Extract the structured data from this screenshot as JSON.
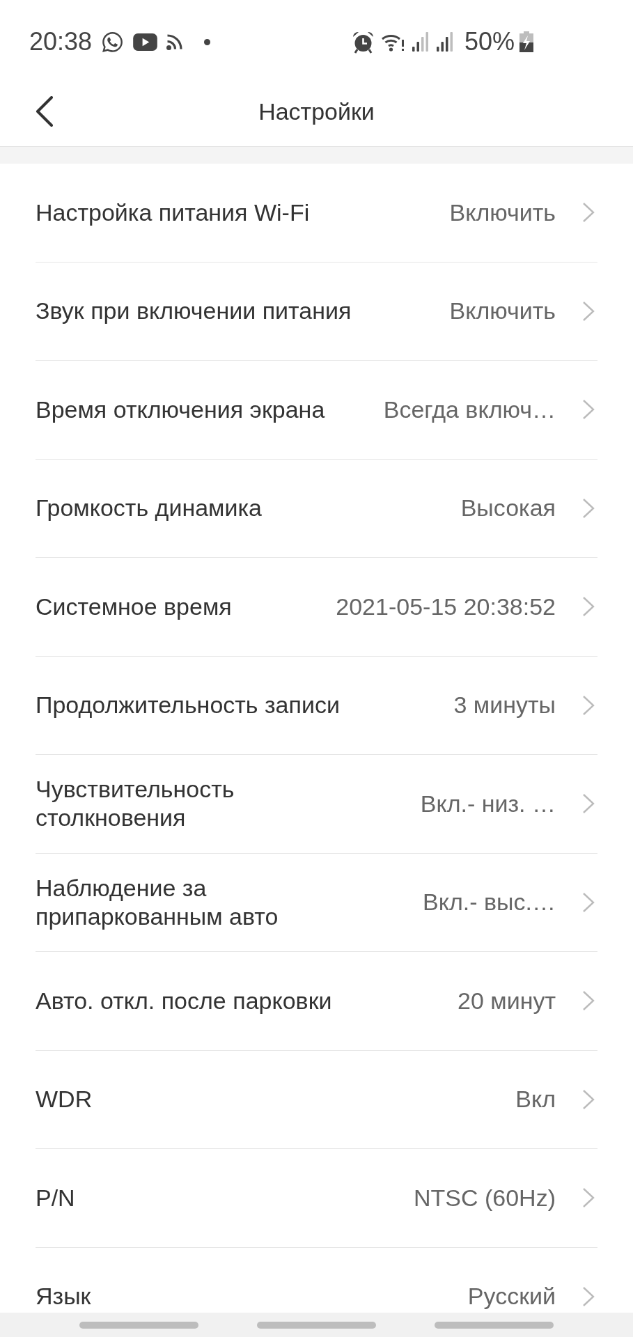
{
  "status_bar": {
    "time": "20:38",
    "battery": "50%"
  },
  "header": {
    "title": "Настройки"
  },
  "settings": [
    {
      "label": "Настройка питания Wi-Fi",
      "value": "Включить"
    },
    {
      "label": "Звук при включении питания",
      "value": "Включить"
    },
    {
      "label": "Время отключения экрана",
      "value": "Всегда включ…"
    },
    {
      "label": "Громкость динамика",
      "value": "Высокая"
    },
    {
      "label": "Системное время",
      "value": "2021-05-15 20:38:52"
    },
    {
      "label": "Продолжительность записи",
      "value": "3 минуты"
    },
    {
      "label": "Чувствительность столкновения",
      "value": "Вкл.- низ. …"
    },
    {
      "label": "Наблюдение за припаркованным авто",
      "value": "Вкл.- выс.…"
    },
    {
      "label": "Авто. откл. после парковки",
      "value": "20 минут"
    },
    {
      "label": "WDR",
      "value": "Вкл"
    },
    {
      "label": "P/N",
      "value": "NTSC (60Hz)"
    },
    {
      "label": "Язык",
      "value": "Русский"
    }
  ]
}
